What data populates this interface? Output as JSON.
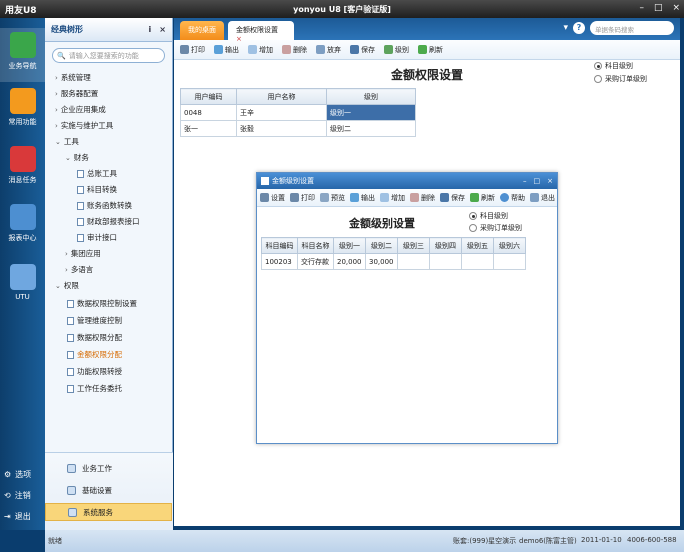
{
  "window": {
    "app_title": "用友U8",
    "center_title": "yonyou U8 [客户验证版]",
    "minimize": "–",
    "maximize": "□",
    "close": "×"
  },
  "leftbar": {
    "items": [
      {
        "label": "业务导航"
      },
      {
        "label": "常用功能"
      },
      {
        "label": "消息任务"
      },
      {
        "label": "报表中心"
      },
      {
        "label": "UTU"
      }
    ],
    "bottom": [
      {
        "label": "选项"
      },
      {
        "label": "注销"
      },
      {
        "label": "退出"
      }
    ]
  },
  "nav": {
    "title": "经典树形",
    "pin": "ⅰ",
    "close": "×",
    "search_placeholder": "请输入您要搜索的功能",
    "tree": [
      "系统管理",
      "服务器配置",
      "企业应用集成",
      "实施与维护工具",
      "工具",
      "财务",
      "总账工具",
      "科目转换",
      "账务函数转换",
      "财政部报表接口",
      "审计接口",
      "集团应用",
      "多语言",
      "权限",
      "数据权限控制设置",
      "管理维度控制",
      "数据权限分配",
      "金额权限分配",
      "功能权限转授",
      "工作任务委托"
    ],
    "footer": [
      {
        "label": "业务工作"
      },
      {
        "label": "基础设置"
      },
      {
        "label": "系统服务"
      }
    ]
  },
  "tabs": {
    "items": [
      {
        "label": "我的桌面"
      },
      {
        "label": "金额权限设置"
      }
    ],
    "search_placeholder": "单据条码搜索"
  },
  "toolbar": {
    "items": [
      "打印",
      "输出",
      "增加",
      "删除",
      "放弃",
      "保存",
      "级别",
      "刷新"
    ]
  },
  "page": {
    "title": "金额权限设置",
    "radio1": "科目级别",
    "radio2": "采购订单级别",
    "grid": {
      "headers": [
        "用户编码",
        "用户名称",
        "级别"
      ],
      "rows": [
        [
          "0048",
          "王辛",
          "级别一"
        ],
        [
          "张一",
          "张毅",
          "级别二"
        ]
      ]
    }
  },
  "dialog": {
    "title": "金额级别设置",
    "toolbar": [
      "设置",
      "打印",
      "预览",
      "输出",
      "增加",
      "删除",
      "保存",
      "刷新",
      "帮助",
      "退出"
    ],
    "heading": "金额级别设置",
    "radio1": "科目级别",
    "radio2": "采购订单级别",
    "grid": {
      "headers": [
        "科目编码",
        "科目名称",
        "级别一",
        "级别二",
        "级别三",
        "级别四",
        "级别五",
        "级别六"
      ],
      "rows": [
        [
          "100203",
          "交行存款",
          "20,000",
          "30,000",
          "",
          "",
          "",
          ""
        ]
      ]
    }
  },
  "status": {
    "ready": "就绪",
    "account": "账套:(999)星空演示",
    "operator": "demo6(陈富主管)",
    "date": "2011-01-10",
    "phone": "4006-600-588"
  },
  "colors": {
    "accent": "#2c74b8",
    "orange": "#f38d1b",
    "selected_row": "#3d6ea8"
  }
}
